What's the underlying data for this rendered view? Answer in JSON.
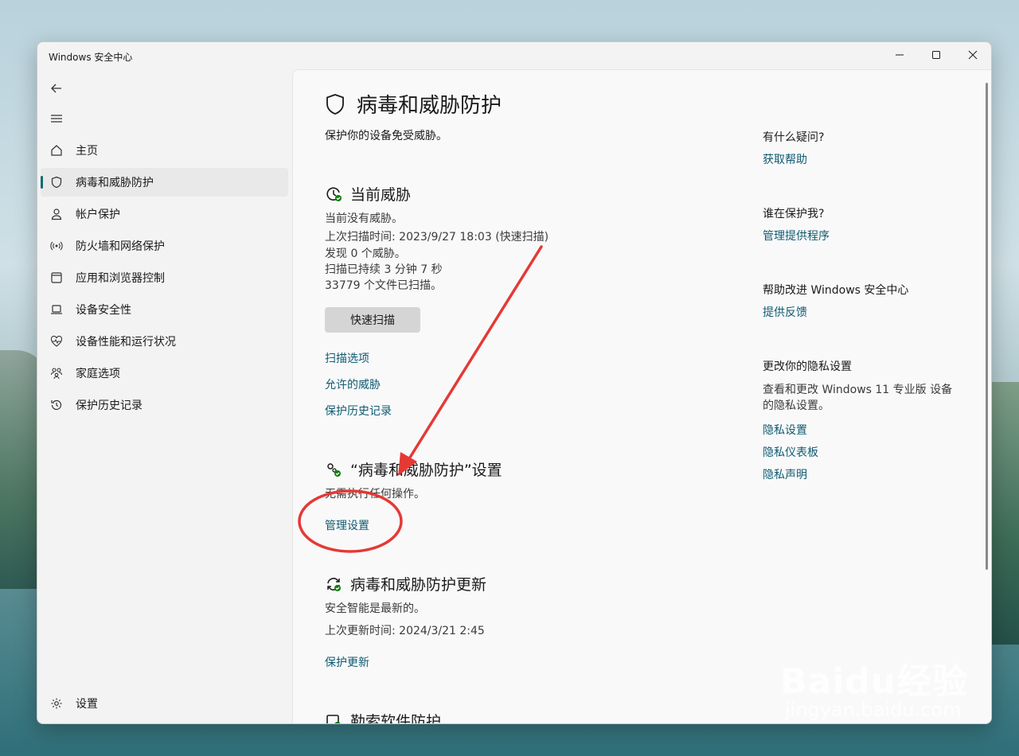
{
  "window": {
    "title": "Windows 安全中心",
    "controls": [
      "minimize",
      "maximize",
      "close"
    ]
  },
  "sidebar": {
    "back_icon": "back-arrow-icon",
    "menu_icon": "hamburger-icon",
    "items": [
      {
        "label": "主页",
        "icon": "home-icon",
        "active": false
      },
      {
        "label": "病毒和威胁防护",
        "icon": "shield-icon",
        "active": true
      },
      {
        "label": "帐户保护",
        "icon": "person-icon",
        "active": false
      },
      {
        "label": "防火墙和网络保护",
        "icon": "wifi-antenna-icon",
        "active": false
      },
      {
        "label": "应用和浏览器控制",
        "icon": "app-window-icon",
        "active": false
      },
      {
        "label": "设备安全性",
        "icon": "laptop-icon",
        "active": false
      },
      {
        "label": "设备性能和运行状况",
        "icon": "heart-pulse-icon",
        "active": false
      },
      {
        "label": "家庭选项",
        "icon": "family-icon",
        "active": false
      },
      {
        "label": "保护历史记录",
        "icon": "history-icon",
        "active": false
      }
    ],
    "settings": {
      "label": "设置",
      "icon": "gear-icon"
    }
  },
  "main": {
    "title": "病毒和威胁防护",
    "subtitle": "保护你的设备免受威胁。",
    "current_threats": {
      "title": "当前威胁",
      "lines": [
        "当前没有威胁。",
        "上次扫描时间: 2023/9/27 18:03 (快速扫描)",
        "发现 0 个威胁。",
        "扫描已持续 3 分钟 7 秒",
        "33779 个文件已扫描。"
      ],
      "quick_scan_button": "快速扫描",
      "links": [
        "扫描选项",
        "允许的威胁",
        "保护历史记录"
      ]
    },
    "settings_section": {
      "title": "“病毒和威胁防护”设置",
      "text": "无需执行任何操作。",
      "link": "管理设置"
    },
    "updates_section": {
      "title": "病毒和威胁防护更新",
      "lines": [
        "安全智能是最新的。",
        "上次更新时间: 2024/3/21 2:45"
      ],
      "link": "保护更新"
    },
    "ransomware_section": {
      "title": "勒索软件防护"
    }
  },
  "right_panel": {
    "questions": {
      "title": "有什么疑问?",
      "link": "获取帮助"
    },
    "who_protects": {
      "title": "谁在保护我?",
      "link": "管理提供程序"
    },
    "improve": {
      "title": "帮助改进 Windows 安全中心",
      "link": "提供反馈"
    },
    "privacy": {
      "title": "更改你的隐私设置",
      "text": "查看和更改 Windows 11 专业版 设备的隐私设置。",
      "links": [
        "隐私设置",
        "隐私仪表板",
        "隐私声明"
      ]
    }
  },
  "annotation": {
    "color": "#e53935"
  },
  "watermark": {
    "main": "Baidu经验",
    "sub": "jingyan.baidu.com"
  }
}
